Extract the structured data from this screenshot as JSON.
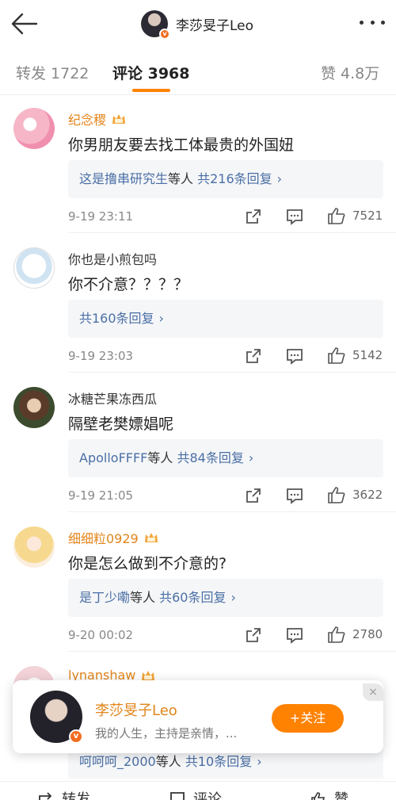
{
  "header": {
    "title": "李莎旻子Leo",
    "badge": "v"
  },
  "tabs": {
    "repost": "转发 1722",
    "comments": "评论 3968",
    "likes": "赞 4.8万"
  },
  "comments": [
    {
      "name": "纪念稷",
      "text": "你男朋友要去找工体最贵的外国妞",
      "reply_prefix": "这是撸串研究生",
      "reply_mid": "等人",
      "reply_count": "共216条回复",
      "time": "9-19 23:11",
      "likes": "7521"
    },
    {
      "name": "你也是小煎包吗",
      "text": "你不介意？？？？",
      "reply_prefix": "",
      "reply_mid": "",
      "reply_count": "共160条回复",
      "time": "9-19 23:03",
      "likes": "5142"
    },
    {
      "name": "冰糖芒果冻西瓜",
      "text": "隔壁老樊嫖娼呢",
      "reply_prefix": "ApolloFFFF",
      "reply_mid": "等人",
      "reply_count": "共84条回复",
      "time": "9-19 21:05",
      "likes": "3622"
    },
    {
      "name": "细细粒0929",
      "text": "你是怎么做到不介意的?",
      "reply_prefix": "是丁少嘞",
      "reply_mid": "等人",
      "reply_count": "共60条回复",
      "time": "9-20 00:02",
      "likes": "2780"
    },
    {
      "name": "lynanshaw"
    }
  ],
  "bottom_reply": {
    "prefix": "呵呵呵_2000",
    "mid": "等人",
    "count": "共10条回复"
  },
  "popup": {
    "name": "李莎旻子Leo",
    "bio": "我的人生，主持是亲情，...",
    "follow": "+关注",
    "close": "×"
  },
  "bottom_bar": {
    "repost": "转发",
    "comment": "评论",
    "like": "赞"
  },
  "colors": {
    "accent": "#ff8200",
    "link": "#4a6fa5",
    "vip_name": "#e2851c"
  }
}
